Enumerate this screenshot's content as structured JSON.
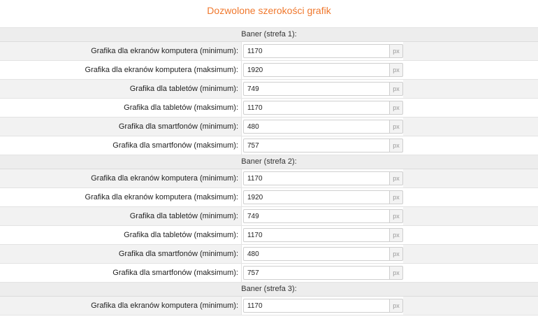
{
  "title": "Dozwolone szerokości grafik",
  "sections": [
    {
      "heading": "Baner (strefa 1):",
      "rows": [
        {
          "label": "Grafika dla ekranów komputera (minimum):",
          "value": "1170",
          "unit": "px"
        },
        {
          "label": "Grafika dla ekranów komputera (maksimum):",
          "value": "1920",
          "unit": "px"
        },
        {
          "label": "Grafika dla tabletów (minimum):",
          "value": "749",
          "unit": "px"
        },
        {
          "label": "Grafika dla tabletów (maksimum):",
          "value": "1170",
          "unit": "px"
        },
        {
          "label": "Grafika dla smartfonów (minimum):",
          "value": "480",
          "unit": "px"
        },
        {
          "label": "Grafika dla smartfonów (maksimum):",
          "value": "757",
          "unit": "px"
        }
      ]
    },
    {
      "heading": "Baner (strefa 2):",
      "rows": [
        {
          "label": "Grafika dla ekranów komputera (minimum):",
          "value": "1170",
          "unit": "px"
        },
        {
          "label": "Grafika dla ekranów komputera (maksimum):",
          "value": "1920",
          "unit": "px"
        },
        {
          "label": "Grafika dla tabletów (minimum):",
          "value": "749",
          "unit": "px"
        },
        {
          "label": "Grafika dla tabletów (maksimum):",
          "value": "1170",
          "unit": "px"
        },
        {
          "label": "Grafika dla smartfonów (minimum):",
          "value": "480",
          "unit": "px"
        },
        {
          "label": "Grafika dla smartfonów (maksimum):",
          "value": "757",
          "unit": "px"
        }
      ]
    },
    {
      "heading": "Baner (strefa 3):",
      "rows": [
        {
          "label": "Grafika dla ekranów komputera (minimum):",
          "value": "1170",
          "unit": "px"
        }
      ]
    }
  ],
  "colors": {
    "title": "#f0782d",
    "section_background": "#ededed",
    "row_stripe": "#f2f2f2"
  }
}
